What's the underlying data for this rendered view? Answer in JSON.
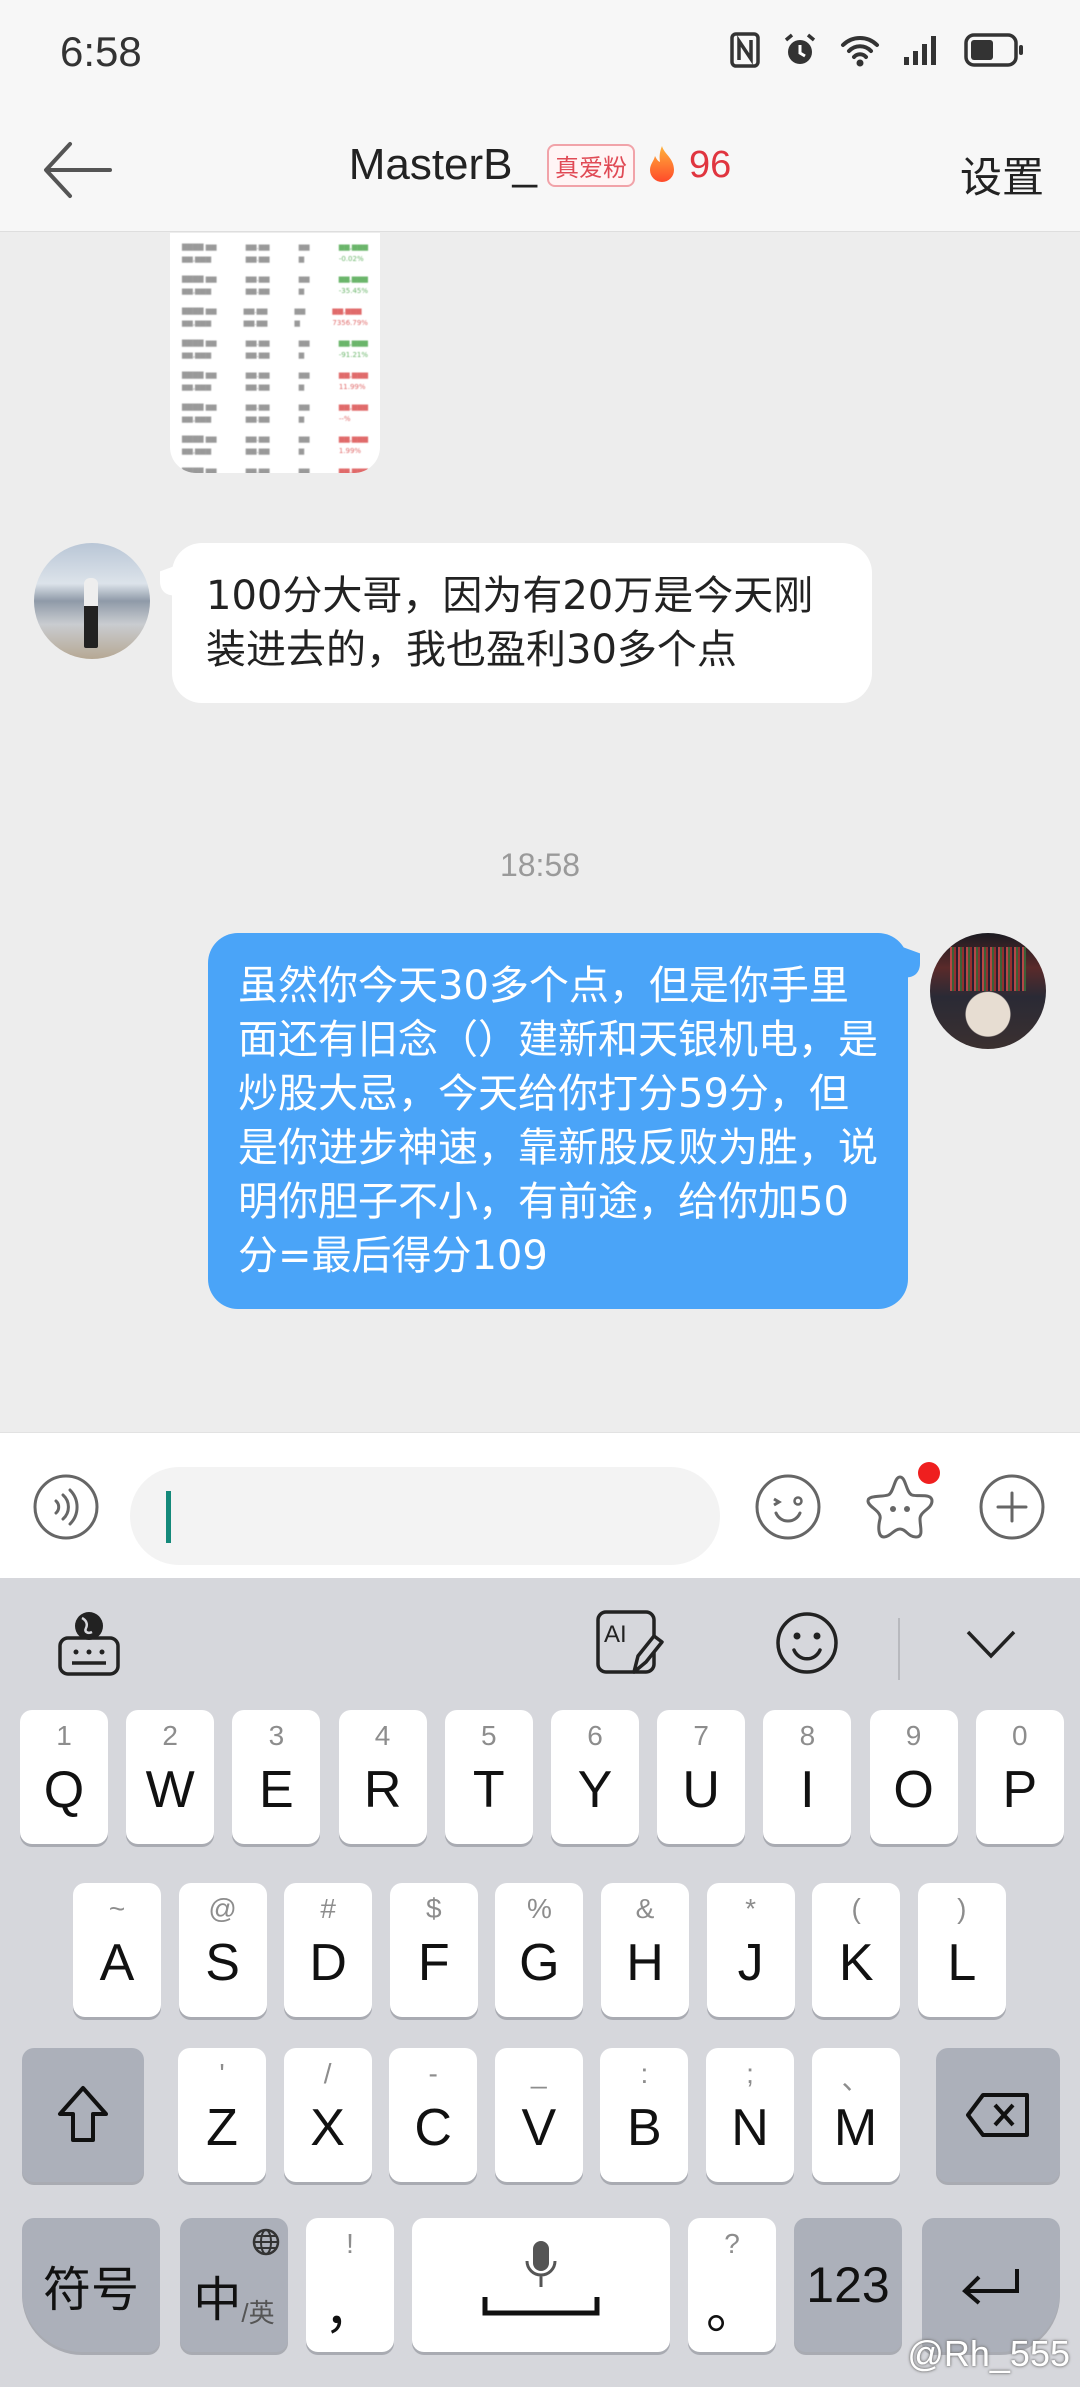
{
  "status_bar": {
    "time": "6:58",
    "icons": [
      "nfc-icon",
      "alarm-icon",
      "wifi-icon",
      "signal-icon",
      "battery-icon"
    ],
    "battery_level": 0.5
  },
  "header": {
    "back_icon": "arrow-left-icon",
    "title": "MasterB_",
    "fan_badge": "真爱粉",
    "fire_icon": "fire-icon",
    "intimacy_count": "96",
    "settings_label": "设置"
  },
  "chat": {
    "messages": [
      {
        "type": "image",
        "direction": "incoming",
        "description": "stock holdings screenshot (blurred)",
        "rows": [
          {
            "a": "",
            "b": "",
            "c": "",
            "d": "-0.02%",
            "trend": "neg"
          },
          {
            "a": "",
            "b": "",
            "c": "",
            "d": "-35.45%",
            "trend": "neg"
          },
          {
            "a": "",
            "b": "",
            "c": "",
            "d": "7356.79%",
            "trend": "pos"
          },
          {
            "a": "",
            "b": "",
            "c": "",
            "d": "-91.21%",
            "trend": "neg"
          },
          {
            "a": "",
            "b": "",
            "c": "",
            "d": "11.99%",
            "trend": "pos"
          },
          {
            "a": "",
            "b": "",
            "c": "",
            "d": "--%",
            "trend": "pos"
          },
          {
            "a": "",
            "b": "",
            "c": "",
            "d": "1.99%",
            "trend": "pos"
          },
          {
            "a": "",
            "b": "",
            "c": "",
            "d": "--%",
            "trend": "pos"
          }
        ]
      },
      {
        "type": "text",
        "direction": "incoming",
        "text": "100分大哥，因为有20万是今天刚装进去的，我也盈利30多个点"
      },
      {
        "type": "timestamp",
        "text": "18:58"
      },
      {
        "type": "text",
        "direction": "outgoing",
        "text": "虽然你今天30多个点，但是你手里面还有旧念（）建新和天银机电，是炒股大忌，今天给你打分59分，但是你进步神速，靠新股反败为胜，说明你胆子不小，有前途，给你加50分=最后得分109"
      }
    ]
  },
  "input_bar": {
    "voice_icon": "voice-icon",
    "input_value": "",
    "emoji_icon": "emoji-icon",
    "sticker_icon": "sticker-star-icon",
    "sticker_has_notification": true,
    "plus_icon": "plus-circle-icon"
  },
  "keyboard": {
    "toolbar": [
      "keyboard-globe-icon",
      "ai-write-icon",
      "emoji-icon",
      "collapse-chevron-icon"
    ],
    "row1": [
      {
        "main": "Q",
        "sub": "1"
      },
      {
        "main": "W",
        "sub": "2"
      },
      {
        "main": "E",
        "sub": "3"
      },
      {
        "main": "R",
        "sub": "4"
      },
      {
        "main": "T",
        "sub": "5"
      },
      {
        "main": "Y",
        "sub": "6"
      },
      {
        "main": "U",
        "sub": "7"
      },
      {
        "main": "I",
        "sub": "8"
      },
      {
        "main": "O",
        "sub": "9"
      },
      {
        "main": "P",
        "sub": "0"
      }
    ],
    "row2": [
      {
        "main": "A",
        "sub": "~"
      },
      {
        "main": "S",
        "sub": "@"
      },
      {
        "main": "D",
        "sub": "#"
      },
      {
        "main": "F",
        "sub": "$"
      },
      {
        "main": "G",
        "sub": "%"
      },
      {
        "main": "H",
        "sub": "&"
      },
      {
        "main": "J",
        "sub": "*"
      },
      {
        "main": "K",
        "sub": "("
      },
      {
        "main": "L",
        "sub": ")"
      }
    ],
    "row3": [
      {
        "main": "Z",
        "sub": "'"
      },
      {
        "main": "X",
        "sub": "/"
      },
      {
        "main": "C",
        "sub": "-"
      },
      {
        "main": "V",
        "sub": "_"
      },
      {
        "main": "B",
        "sub": ":"
      },
      {
        "main": "N",
        "sub": ";"
      },
      {
        "main": "M",
        "sub": "、"
      }
    ],
    "shift_icon": "shift-icon",
    "backspace_icon": "backspace-icon",
    "symbols_label": "符号",
    "lang_label": "中",
    "lang_sub": "/英",
    "comma": {
      "main": "，",
      "sub": "!"
    },
    "space_icon": "mic-space-icon",
    "period": {
      "main": "。",
      "sub": "?"
    },
    "numbers_label": "123",
    "enter_icon": "enter-icon"
  },
  "watermark": "@Rh_555"
}
